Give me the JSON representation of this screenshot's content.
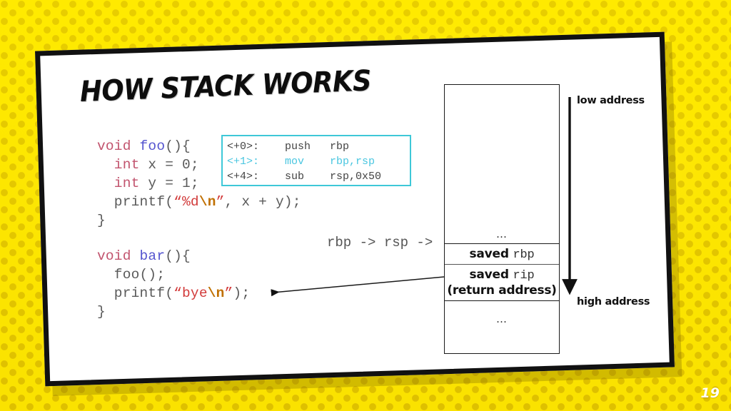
{
  "slide": {
    "title": "HOW STACK WORKS",
    "page_number": "19",
    "background_color": "#ffe800",
    "accent_color": "#3ec8d8",
    "card_background": "#ffffff",
    "card_border_color": "#111111"
  },
  "code_foo": {
    "lines": [
      {
        "parts": [
          {
            "text": "void ",
            "token": "keyword"
          },
          {
            "text": "foo",
            "token": "function"
          },
          {
            "text": "(){",
            "token": "plain"
          }
        ]
      },
      {
        "parts": [
          {
            "text": "  int ",
            "token": "keyword"
          },
          {
            "text": "x = 0;",
            "token": "plain"
          }
        ]
      },
      {
        "parts": [
          {
            "text": "  int ",
            "token": "keyword"
          },
          {
            "text": "y = 1;",
            "token": "plain"
          }
        ]
      },
      {
        "parts": [
          {
            "text": "  printf(",
            "token": "plain"
          },
          {
            "text": "“%d",
            "token": "string"
          },
          {
            "text": "\\n",
            "token": "escape"
          },
          {
            "text": "”",
            "token": "string"
          },
          {
            "text": ", x + y);",
            "token": "plain"
          }
        ]
      },
      {
        "parts": [
          {
            "text": "}",
            "token": "plain"
          }
        ]
      }
    ]
  },
  "code_bar": {
    "lines": [
      {
        "parts": [
          {
            "text": "void ",
            "token": "keyword"
          },
          {
            "text": "bar",
            "token": "function"
          },
          {
            "text": "(){",
            "token": "plain"
          }
        ]
      },
      {
        "parts": [
          {
            "text": "  foo();",
            "token": "plain"
          }
        ]
      },
      {
        "parts": [
          {
            "text": "  printf(",
            "token": "plain"
          },
          {
            "text": "“bye",
            "token": "string"
          },
          {
            "text": "\\n",
            "token": "escape"
          },
          {
            "text": "”",
            "token": "string"
          },
          {
            "text": ");",
            "token": "plain"
          }
        ]
      },
      {
        "parts": [
          {
            "text": "}",
            "token": "plain"
          }
        ]
      }
    ]
  },
  "assembly": {
    "border_color": "#3ec8d8",
    "highlight_color": "#49c6e0",
    "lines": [
      {
        "offset": "<+0>:",
        "mnemonic": "push",
        "operands": "rbp",
        "highlighted": false
      },
      {
        "offset": "<+1>:",
        "mnemonic": "mov",
        "operands": "rbp,rsp",
        "highlighted": true
      },
      {
        "offset": "<+4>:",
        "mnemonic": "sub",
        "operands": "rsp,0x50",
        "highlighted": false
      }
    ]
  },
  "pointer_label": "rbp -> rsp ->",
  "stack": {
    "cells": [
      {
        "id": "top",
        "text": "…",
        "sub": ""
      },
      {
        "id": "rbp",
        "text": "saved",
        "reg": "rbp",
        "sub": ""
      },
      {
        "id": "rip",
        "text": "saved",
        "reg": "rip",
        "sub": "(return address)"
      },
      {
        "id": "bottom",
        "text": "…",
        "sub": ""
      }
    ]
  },
  "address_axis": {
    "low_label": "low address",
    "high_label": "high address",
    "direction": "down"
  }
}
